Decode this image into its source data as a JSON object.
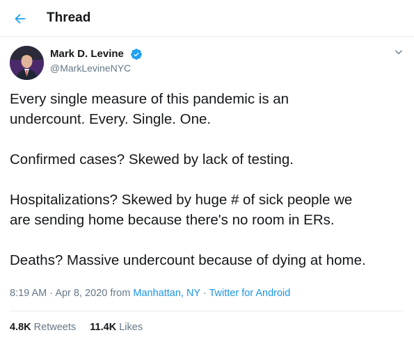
{
  "header": {
    "title": "Thread"
  },
  "author": {
    "name": "Mark D. Levine",
    "handle": "@MarkLevineNYC"
  },
  "tweet": {
    "lines": [
      "Every single measure of this pandemic is an",
      "undercount. Every. Single. One.",
      "Confirmed cases? Skewed by lack of testing.",
      "Hospitalizations? Skewed by huge # of sick people we",
      "are sending home because there's no room in ERs.",
      "Deaths? Massive undercount because of dying at home."
    ]
  },
  "meta": {
    "time": "8:19 AM",
    "sep1": "·",
    "date": "Apr 8, 2020",
    "from_label": "from",
    "location": "Manhattan, NY",
    "sep2": "·",
    "source": "Twitter for Android"
  },
  "stats": {
    "retweets_count": "4.8K",
    "retweets_label": "Retweets",
    "likes_count": "11.4K",
    "likes_label": "Likes"
  },
  "colors": {
    "accent": "#1da1f2",
    "text": "#14171a",
    "muted": "#657786",
    "border": "#e6ecf0"
  },
  "icons": {
    "back": "arrow-left-icon",
    "verified": "verified-badge-icon",
    "more": "chevron-down-icon"
  }
}
